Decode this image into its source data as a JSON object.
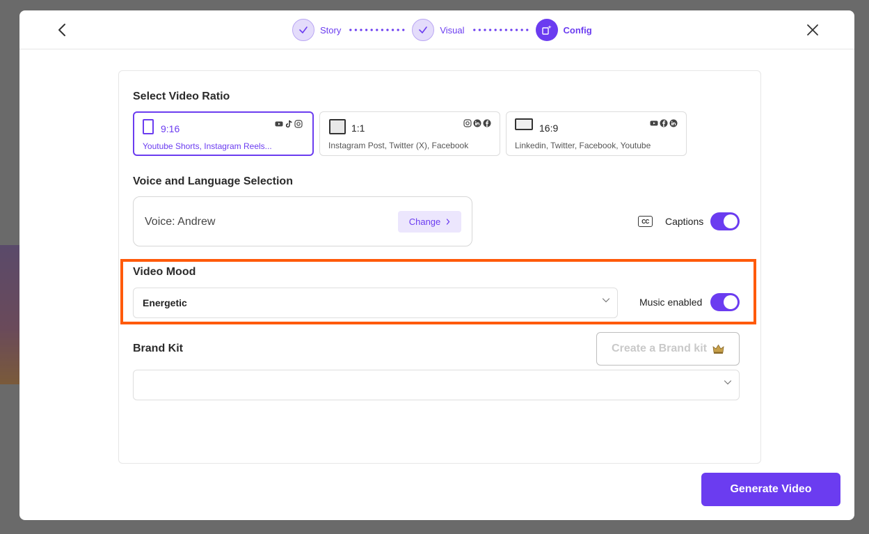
{
  "stepper": {
    "steps": [
      {
        "label": "Story",
        "state": "done"
      },
      {
        "label": "Visual",
        "state": "done"
      },
      {
        "label": "Config",
        "state": "active"
      }
    ]
  },
  "ratio_section": {
    "title": "Select Video Ratio",
    "options": [
      {
        "ratio": "9:16",
        "platforms": "Youtube Shorts, Instagram Reels...",
        "selected": true,
        "icons": [
          "youtube-icon",
          "tiktok-icon",
          "instagram-icon"
        ]
      },
      {
        "ratio": "1:1",
        "platforms": "Instagram Post, Twitter (X), Facebook",
        "selected": false,
        "icons": [
          "instagram-icon",
          "linkedin-icon",
          "facebook-icon"
        ]
      },
      {
        "ratio": "16:9",
        "platforms": "Linkedin, Twitter, Facebook, Youtube",
        "selected": false,
        "icons": [
          "youtube-icon",
          "facebook-icon",
          "linkedin-icon"
        ]
      }
    ]
  },
  "voice_section": {
    "title": "Voice and Language Selection",
    "voice_text": "Voice: Andrew",
    "change_label": "Change",
    "captions_label": "Captions",
    "cc_text": "CC",
    "captions_enabled": true
  },
  "mood_section": {
    "title": "Video Mood",
    "selected_mood": "Energetic",
    "music_label": "Music enabled",
    "music_enabled": true
  },
  "brand_section": {
    "title": "Brand Kit",
    "create_label": "Create a Brand kit",
    "selected_value": ""
  },
  "footer": {
    "generate_label": "Generate Video"
  },
  "colors": {
    "accent": "#6b3cf0",
    "highlight": "#ff5a0a"
  }
}
